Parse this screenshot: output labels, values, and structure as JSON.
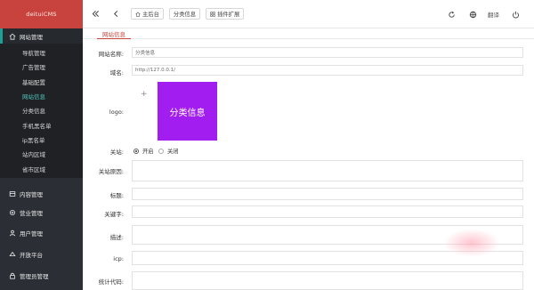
{
  "brand": "deituiCMS",
  "sidebar": {
    "site_group": "网站管理",
    "site_items": [
      "导航管理",
      "广告管理",
      "基础配置",
      "网站信息",
      "分类信息",
      "手机黑名单",
      "ip黑名单",
      "站内区域",
      "省市区域"
    ],
    "active_item_index": 3,
    "other_groups": [
      "内容管理",
      "营业管理",
      "用户管理",
      "开放平台",
      "管理员管理"
    ]
  },
  "topbar": {
    "home": "主后台",
    "category": "分类信息",
    "plugins": "插件扩展",
    "translate": "翻译"
  },
  "tab": "网站信息",
  "form": {
    "site_name_label": "网站名称:",
    "site_name_value": "分类信息",
    "domain_label": "域名:",
    "domain_value": "http://127.0.0.1/",
    "logo_label": "logo:",
    "logo_text": "分类信息",
    "logo_plus": "+",
    "close_label": "关站:",
    "open_option": "开启",
    "close_option": "关闭",
    "close_reason_label": "关站原因:",
    "title_label": "标题:",
    "keywords_label": "关键字:",
    "desc_label": "描述:",
    "icp_label": "icp:",
    "stats_label": "统计代码:"
  },
  "colors": {
    "accent": "#c8433d",
    "sidebar_bg": "#2b2e34",
    "logo_bg": "#a21df0",
    "active_link": "#52c6bb"
  }
}
